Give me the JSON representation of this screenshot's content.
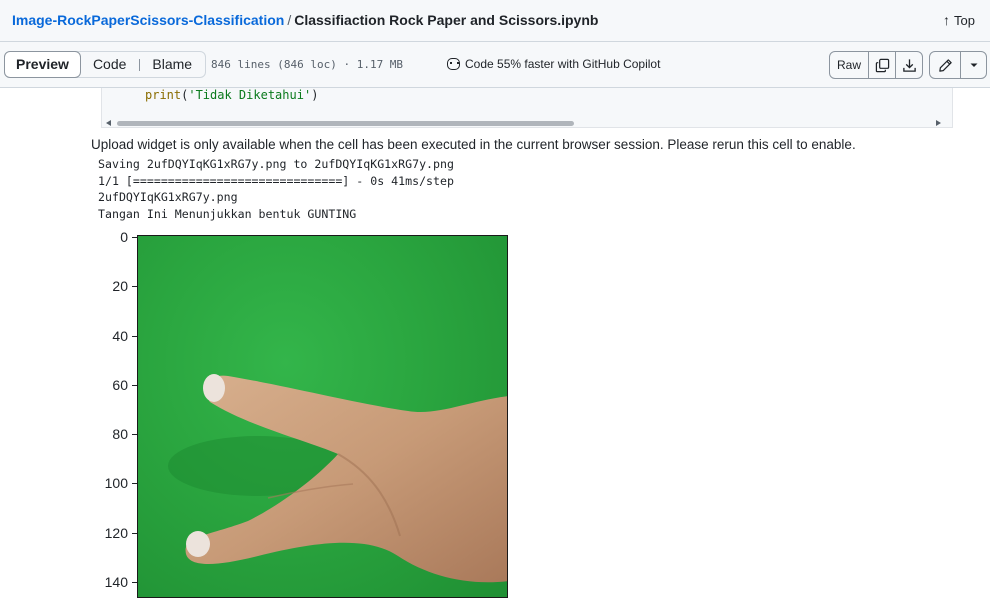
{
  "breadcrumb": {
    "repo": "Image-RockPaperScissors-Classification",
    "separator": "/",
    "file": "Classifiaction Rock Paper and Scissors.ipynb"
  },
  "top_link": "Top",
  "tabs": [
    {
      "label": "Preview",
      "active": true
    },
    {
      "label": "Code",
      "active": false
    },
    {
      "label": "Blame",
      "active": false
    }
  ],
  "file_meta": "846 lines (846 loc) · 1.17 MB",
  "copilot_promo": "Code 55% faster with GitHub Copilot",
  "actions": {
    "raw": "Raw",
    "copy_icon": "copy-icon",
    "download_icon": "download-icon",
    "edit_icon": "pencil-icon",
    "more_icon": "chevron-down-icon"
  },
  "code": {
    "fn": "print",
    "open": "(",
    "str": "'Tidak Diketahui'",
    "close": ")"
  },
  "notice": "Upload widget is only available when the cell has been executed in the current browser session. Please rerun this cell to enable.",
  "output_lines": [
    "Saving 2ufDQYIqKG1xRG7y.png to 2ufDQYIqKG1xRG7y.png",
    "1/1 [==============================] - 0s 41ms/step",
    "2ufDQYIqKG1xRG7y.png",
    "Tangan Ini Menunjukkan bentuk GUNTING"
  ],
  "plot_y_ticks": [
    "0",
    "20",
    "40",
    "60",
    "80",
    "100",
    "120",
    "140"
  ],
  "colors": {
    "link": "#0969da",
    "background_green": "#2aa53f",
    "skin": "#c99c7a"
  }
}
